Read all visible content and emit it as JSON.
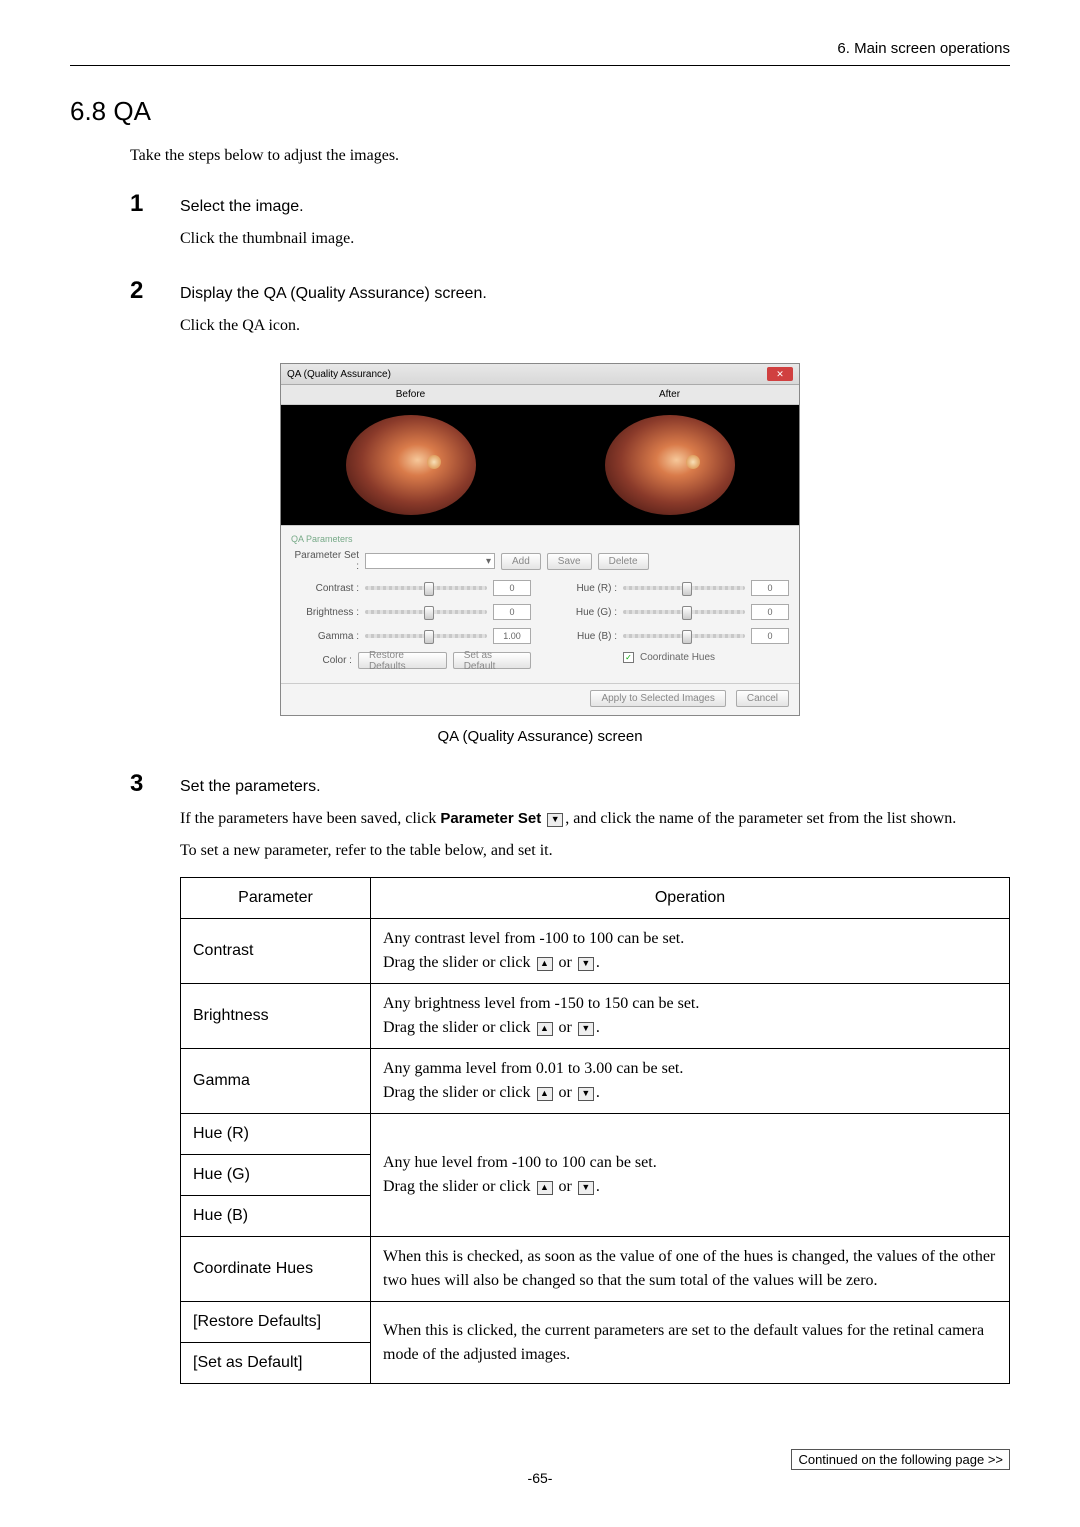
{
  "header": {
    "chapter": "6. Main screen operations"
  },
  "section": {
    "number_title": "6.8 QA"
  },
  "intro": "Take the steps below to adjust the images.",
  "steps": {
    "s1": {
      "num": "1",
      "title": "Select the image.",
      "body1": "Click the thumbnail image."
    },
    "s2": {
      "num": "2",
      "title": "Display the QA (Quality Assurance) screen.",
      "body1": "Click the QA icon."
    },
    "s3": {
      "num": "3",
      "title": "Set the parameters.",
      "body1a": "If the parameters have been saved, click ",
      "paramset_label": "Parameter Set",
      "body1b": ", and click the name of the parameter set from the list shown.",
      "body2": "To set a new parameter, refer to the table below, and set it."
    }
  },
  "qa_screen": {
    "window_title": "QA (Quality Assurance)",
    "before": "Before",
    "after": "After",
    "params_title": "QA Parameters",
    "paramset": "Parameter Set :",
    "add": "Add",
    "save": "Save",
    "delete": "Delete",
    "contrast": "Contrast :",
    "brightness": "Brightness :",
    "gamma": "Gamma :",
    "color": "Color :",
    "hue_r": "Hue (R) :",
    "hue_g": "Hue (G) :",
    "hue_b": "Hue (B) :",
    "contrast_val": "0",
    "brightness_val": "0",
    "gamma_val": "1.00",
    "hue_val": "0",
    "coord_hues": "Coordinate Hues",
    "restore": "Restore Defaults",
    "setdef": "Set as Default",
    "apply": "Apply to Selected Images",
    "cancel": "Cancel"
  },
  "screenshot_caption": "QA (Quality Assurance) screen",
  "table": {
    "hdr_param": "Parameter",
    "hdr_op": "Operation",
    "rows": {
      "contrast": {
        "name": "Contrast",
        "op_a": "Any contrast level from -100 to 100 can be set.",
        "op_b": "Drag the slider or click ",
        "op_or": " or ",
        "op_end": "."
      },
      "brightness": {
        "name": "Brightness",
        "op_a": "Any brightness level from -150 to 150 can be set.",
        "op_b": "Drag the slider or click ",
        "op_or": " or ",
        "op_end": "."
      },
      "gamma": {
        "name": "Gamma",
        "op_a": "Any gamma level from 0.01 to 3.00 can be set.",
        "op_b": "Drag the slider or click ",
        "op_or": " or ",
        "op_end": "."
      },
      "hue_r": {
        "name": "Hue (R)"
      },
      "hue_g": {
        "name": "Hue (G)"
      },
      "hue_b": {
        "name": "Hue (B)"
      },
      "hue_op": {
        "a": "Any hue level from -100 to 100 can be set.",
        "b": "Drag the slider or click ",
        "or": " or ",
        "end": "."
      },
      "coord": {
        "name": "Coordinate Hues",
        "op": "When this is checked, as soon as the value of one of the hues is changed, the values of the other two hues will also be changed so that the sum total of the values will be zero."
      },
      "restore": {
        "name": "[Restore Defaults]"
      },
      "setdef": {
        "name": "[Set as Default]"
      },
      "restore_op": "When this is clicked, the current parameters are set to the default values for the retinal camera mode of the adjusted images."
    }
  },
  "continued": "Continued on the following page >>",
  "page": "-65-"
}
